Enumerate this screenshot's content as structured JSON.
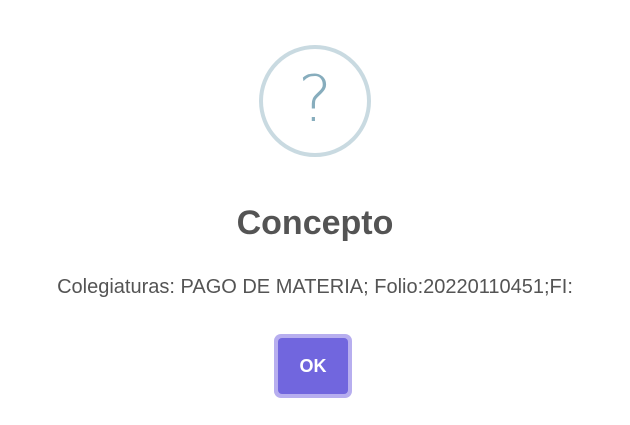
{
  "dialog": {
    "icon": "question-icon",
    "icon_glyph": "?",
    "icon_color": "#87adbd",
    "title": "Concepto",
    "message": "Colegiaturas: PAGO DE MATERIA; Folio:20220110451;FI:",
    "confirm_label": "OK",
    "confirm_color": "#7166de"
  }
}
